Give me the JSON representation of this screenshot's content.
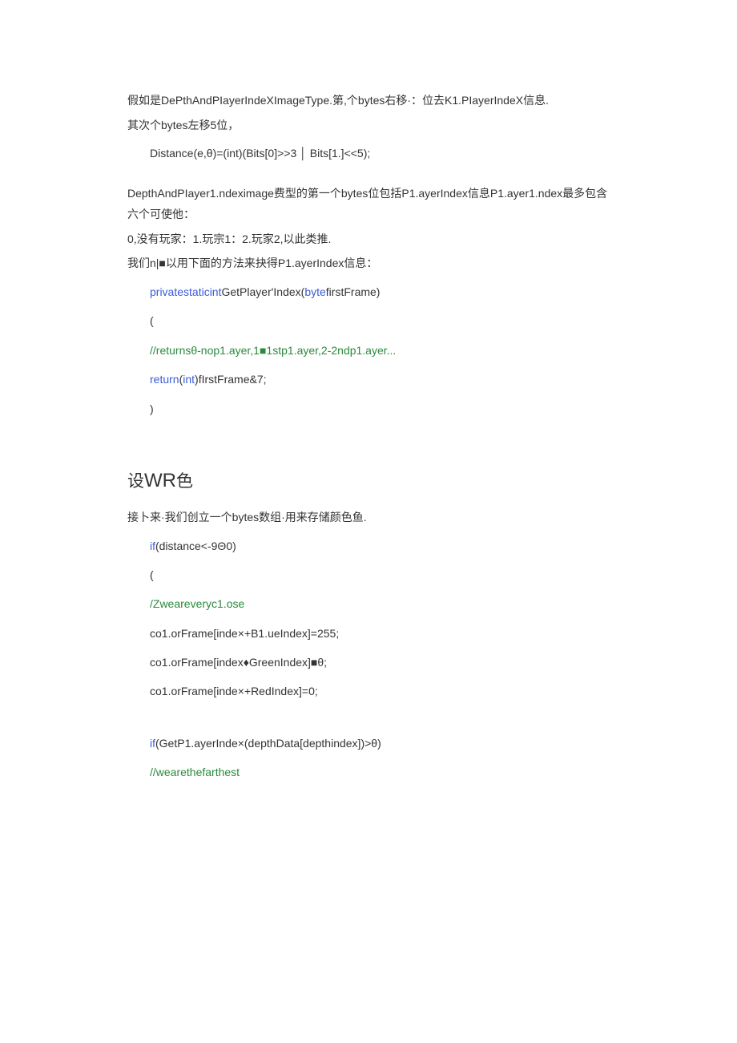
{
  "p1": "假如是DePthAndPIayerIndeXImageType.第,个bytes右移·：位去K1.PIayerIndeX信息.",
  "p2": "其次个bytes左移5位，",
  "c1": "Distance(e,θ)=(int)(Bits[0]>>3 │ Bits[1.]<<5);",
  "p3": "DepthAndPIayer1.ndeximage费型的第一个bytes位包括P1.ayerIndex信息P1.ayer1.ndex最多包含六个可使他：",
  "p4": "0,没有玩家：1.玩宗1：2.玩家2,以此类推.",
  "p5": "我们n|■以用下面的方法来抉得P1.ayerIndex信息：",
  "c2a": "privatestaticint",
  "c2b": "GetPlayer'Index(",
  "c2c": "byte",
  "c2d": "firstFrame)",
  "c3": "(",
  "c4a": "//returnsθ-nop1.ayer,1■1stp1.ayer,2",
  "c4b": "-2ndp1.ayer...",
  "c5a": "return",
  "c5b": "(",
  "c5c": "int",
  "c5d": ")fIrstFrame&7;",
  "c6": ")",
  "h1a": "设",
  "h1b": "WR",
  "h1c": "色",
  "p6": "接卜来·我们创立一个bytes数组·用来存储颜色鱼.",
  "c7a": "if",
  "c7b": "(distance<-9Θ0)",
  "c8": "(",
  "c9": "/Zweareveryc1.ose",
  "c10": "co1.orFrame[inde×+B1.ueIndex]=255;",
  "c11": "co1.orFrame[index♦GreenIndex]■θ;",
  "c12": "co1.orFrame[inde×+RedIndex]=0;",
  "c13a": "if",
  "c13b": "(GetP1.ayerInde×(depthData[depthindex])>θ)",
  "c14": "//wearethefarthest"
}
